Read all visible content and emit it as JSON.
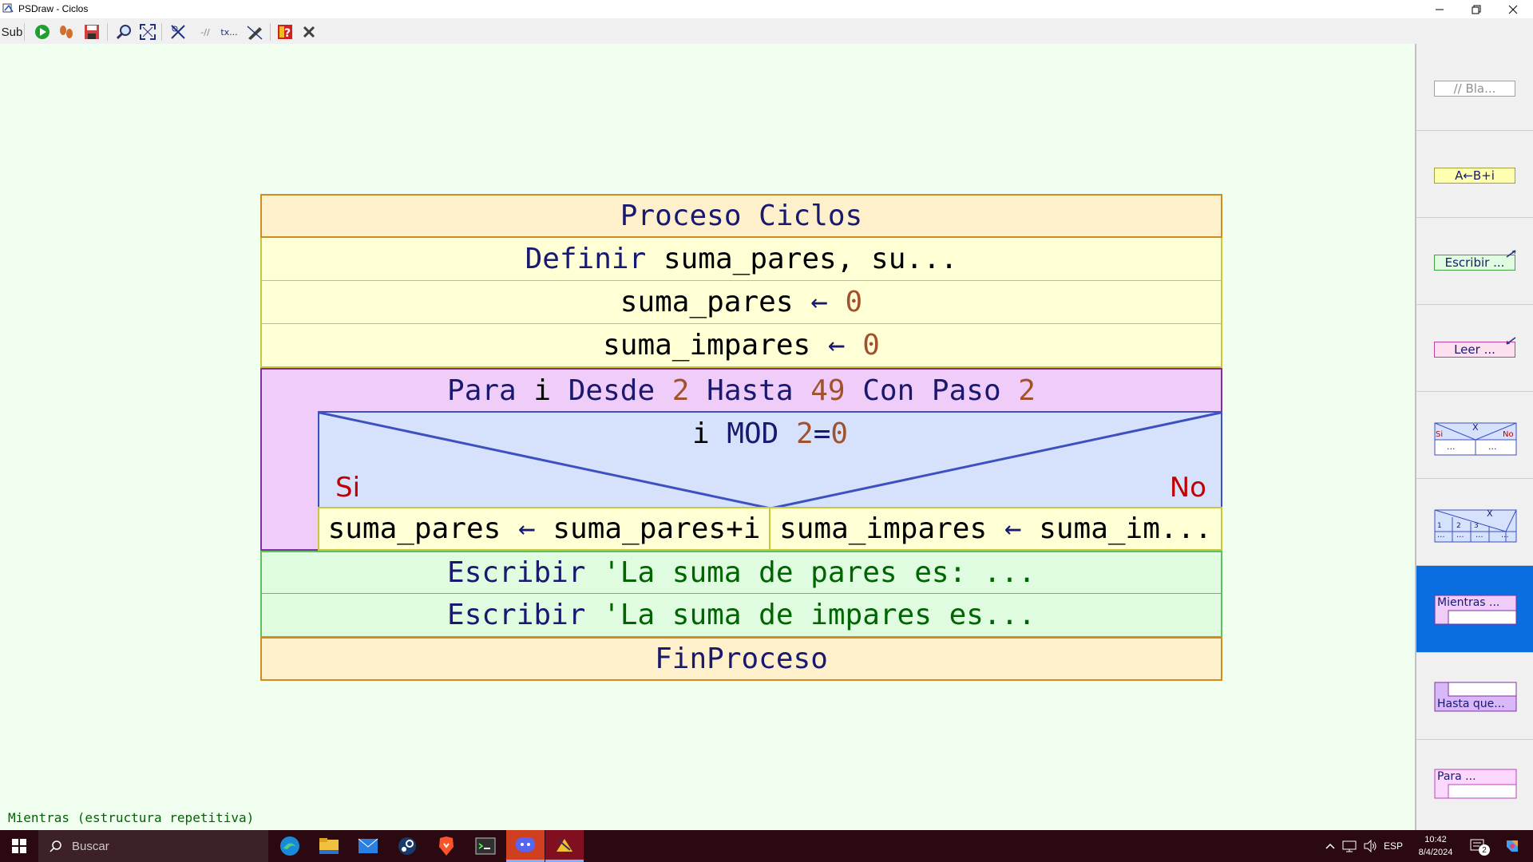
{
  "window": {
    "title": "PSDraw - Ciclos"
  },
  "toolbar": {
    "sub_label": "Sub",
    "comment_label": "-//",
    "text_label": "tx..."
  },
  "diagram": {
    "proceso": "Proceso Ciclos",
    "definir_kw": "Definir",
    "definir_rest": " suma_pares, su...",
    "asig1_var": "suma_pares",
    "asig1_arrow": " ← ",
    "asig1_val": "0",
    "asig2_var": "suma_impares",
    "asig2_arrow": " ← ",
    "asig2_val": "0",
    "para_kw1": "Para",
    "para_var": " i ",
    "para_kw2": "Desde",
    "para_from": " 2 ",
    "para_kw3": "Hasta",
    "para_to": " 49 ",
    "para_kw4": "Con Paso",
    "para_step": " 2",
    "cond_var": "i ",
    "cond_kw": "MOD",
    "cond_num": " 2",
    "cond_eq": "=",
    "cond_zero": "0",
    "si_label": "Si",
    "no_label": "No",
    "branch_si_var": "suma_pares",
    "branch_si_arrow": " ← ",
    "branch_si_expr": "suma_pares+i",
    "branch_no_var": "suma_impares",
    "branch_no_arrow": " ← ",
    "branch_no_expr": "suma_im...",
    "escribir_kw": "Escribir",
    "escribir1_str": " 'La suma de pares es: ...",
    "escribir2_str": " 'La suma de impares es...",
    "fin": "FinProceso"
  },
  "status": "Mientras (estructura repetitiva)",
  "palette": {
    "comment": "// Bla...",
    "assign": "A←B+i",
    "write": "Escribir ...",
    "read": "Leer ...",
    "if_x": "X",
    "if_si": "Si",
    "if_no": "No",
    "if_dots": "...",
    "switch_x": "X",
    "switch_1": "1",
    "switch_2": "2",
    "switch_3": "3",
    "switch_dots": "...",
    "while": "Mientras ...",
    "repeat": "Hasta que...",
    "for": "Para ..."
  },
  "taskbar": {
    "search_placeholder": "Buscar",
    "lang": "ESP",
    "time": "10:42",
    "date": "8/4/2024",
    "notifications": "2"
  }
}
